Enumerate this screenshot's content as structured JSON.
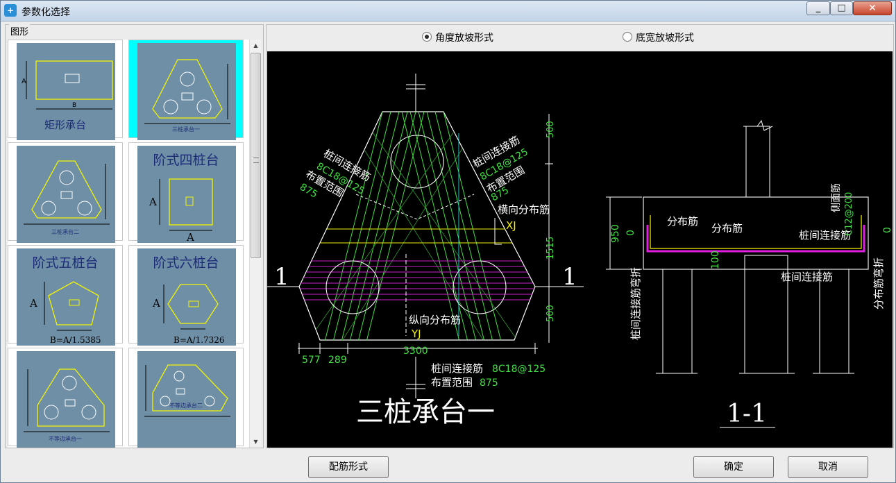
{
  "window": {
    "title": "参数化选择",
    "app_icon": "app-icon"
  },
  "left": {
    "group_label": "图形",
    "thumbnails": [
      {
        "label": "矩形承台",
        "dim_a": "A",
        "dim_b": "B"
      },
      {
        "label": "三桩承台一",
        "selected": true
      },
      {
        "label": "三桩承台二"
      },
      {
        "label": "阶式四桩台",
        "dim_a": "A",
        "dim_b": "A"
      },
      {
        "label": "阶式五桩台",
        "dim_a": "A",
        "formula": "B=A/1.5385"
      },
      {
        "label": "阶式六桩台",
        "dim_a": "A",
        "formula": "B=A/1.7326"
      },
      {
        "label": "不等边承台一"
      },
      {
        "label": "不等边承台二"
      }
    ]
  },
  "options": {
    "angle": {
      "label": "角度放坡形式",
      "checked": true
    },
    "width": {
      "label": "底宽放坡形式",
      "checked": false
    }
  },
  "drawing": {
    "title_main": "三桩承台一",
    "title_section": "1-1",
    "section_mark": "1",
    "labels": {
      "link_rebar_left": "桩间连接筋",
      "link_rebar_left_spec": "8C18@125",
      "range_left": "布置范围",
      "range_left_val": "875",
      "link_rebar_right": "桩间连接筋",
      "link_rebar_right_spec": "8C18@125",
      "range_right": "布置范围",
      "range_right_val": "875",
      "transverse": "横向分布筋",
      "xj": "XJ",
      "longitudinal": "纵向分布筋",
      "yj": "YJ",
      "bottom_link": "桩间连接筋",
      "bottom_link_spec": "8C18@125",
      "bottom_range": "布置范围",
      "bottom_range_val": "875",
      "dim_500_top": "500",
      "dim_1515": "1515",
      "dim_500_bottom": "500",
      "dim_577": "577",
      "dim_289": "289",
      "dim_3300": "3300",
      "sec_dist1": "分布筋",
      "sec_dist2": "分布筋",
      "sec_link": "桩间连接筋",
      "sec_link2": "桩间连接筋",
      "sec_side": "侧面筋",
      "sec_side_spec": "C12@200",
      "sec_950": "950",
      "sec_0_left": "0",
      "sec_0_right": "0",
      "sec_100": "100",
      "sec_left_vert": "桩间连接筋弯折",
      "sec_right_vert": "分布筋弯折"
    }
  },
  "buttons": {
    "rebar": "配筋形式",
    "ok": "确定",
    "cancel": "取消"
  }
}
